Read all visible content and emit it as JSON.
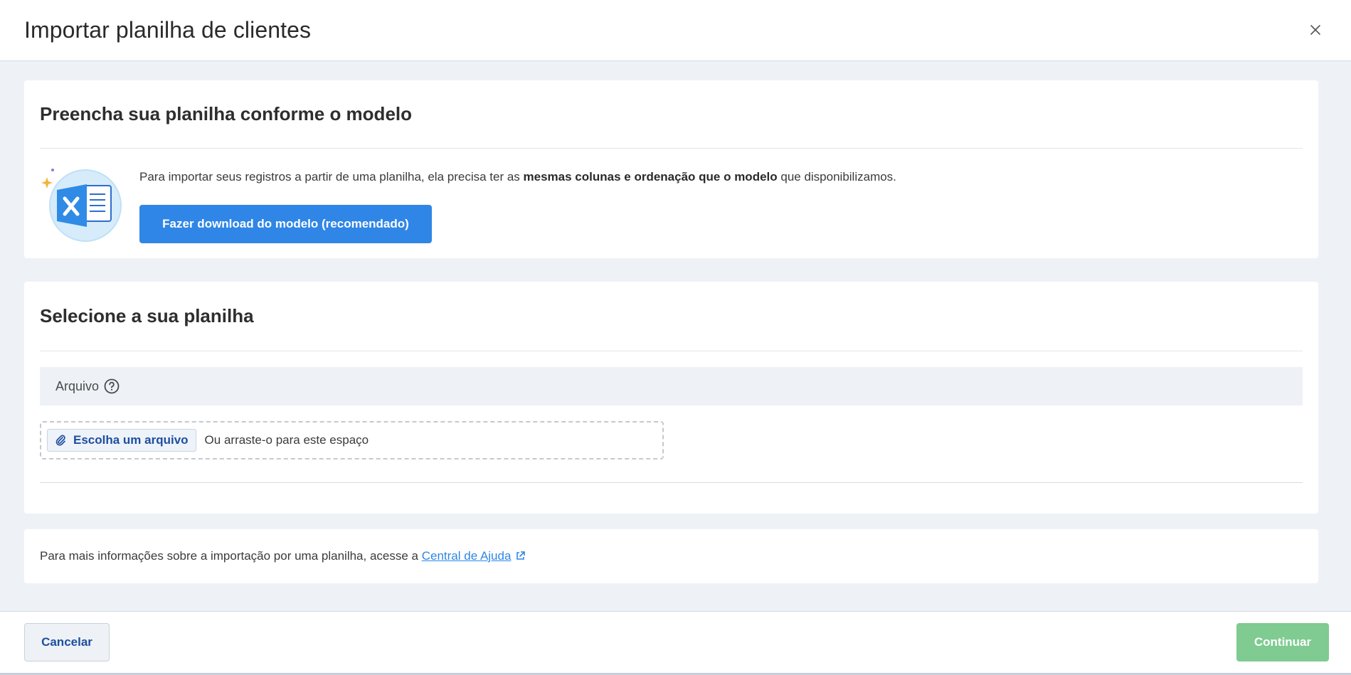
{
  "header": {
    "title": "Importar planilha de clientes",
    "close_icon": "close-icon"
  },
  "model_card": {
    "title": "Preencha sua planilha conforme o modelo",
    "description_prefix": "Para importar seus registros a partir de uma planilha, ela precisa ter as ",
    "description_bold": "mesmas colunas e ordenação que o modelo",
    "description_suffix": " que disponibilizamos.",
    "download_button": "Fazer download do modelo (recomendado)",
    "illustration_icon": "excel-spreadsheet-icon"
  },
  "upload_card": {
    "title": "Selecione a sua planilha",
    "field_label": "Arquivo",
    "choose_button": "Escolha um arquivo",
    "drop_text": "Ou arraste-o para este espaço"
  },
  "help_card": {
    "text": "Para mais informações sobre a importação por uma planilha, acesse a ",
    "link_label": "Central de Ajuda"
  },
  "footer": {
    "cancel_label": "Cancelar",
    "continue_label": "Continuar"
  },
  "colors": {
    "primary": "#2f86e6",
    "continue_disabled": "#7fcb91",
    "link": "#2f86e6",
    "background": "#eef2f7"
  }
}
